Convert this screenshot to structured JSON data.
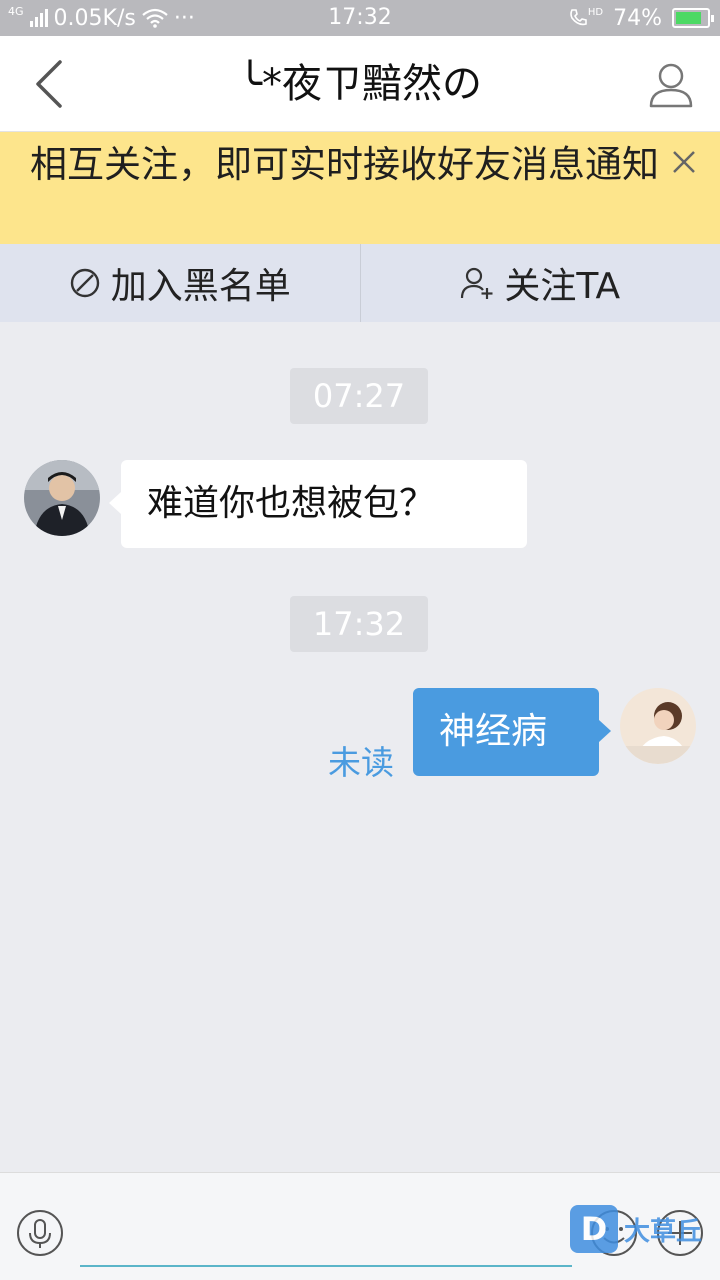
{
  "status_bar": {
    "network": "4G",
    "speed": "0.05K/s",
    "more": "···",
    "time": "17:32",
    "call_hd": "HD",
    "battery": "74%",
    "battery_level": 0.74
  },
  "header": {
    "title": "╰*夜ㄗ黯然の"
  },
  "notice": {
    "text": "相互关注，即可实时接收好友消息通知"
  },
  "actions": {
    "blacklist": "加入黑名单",
    "follow": "关注TA"
  },
  "chat": {
    "messages": [
      {
        "time": "07:27",
        "from": "other",
        "text": "难道你也想被包？"
      },
      {
        "time": "17:32",
        "from": "me",
        "text": "神经病",
        "status": "未读"
      }
    ]
  },
  "input": {
    "placeholder": ""
  },
  "watermark": {
    "logo": "D",
    "text": "大草丘"
  },
  "colors": {
    "accent": "#4a9be0",
    "notice_bg": "#fde58c",
    "action_bg": "#dfe3ee",
    "chat_bg": "#ebecf0"
  }
}
